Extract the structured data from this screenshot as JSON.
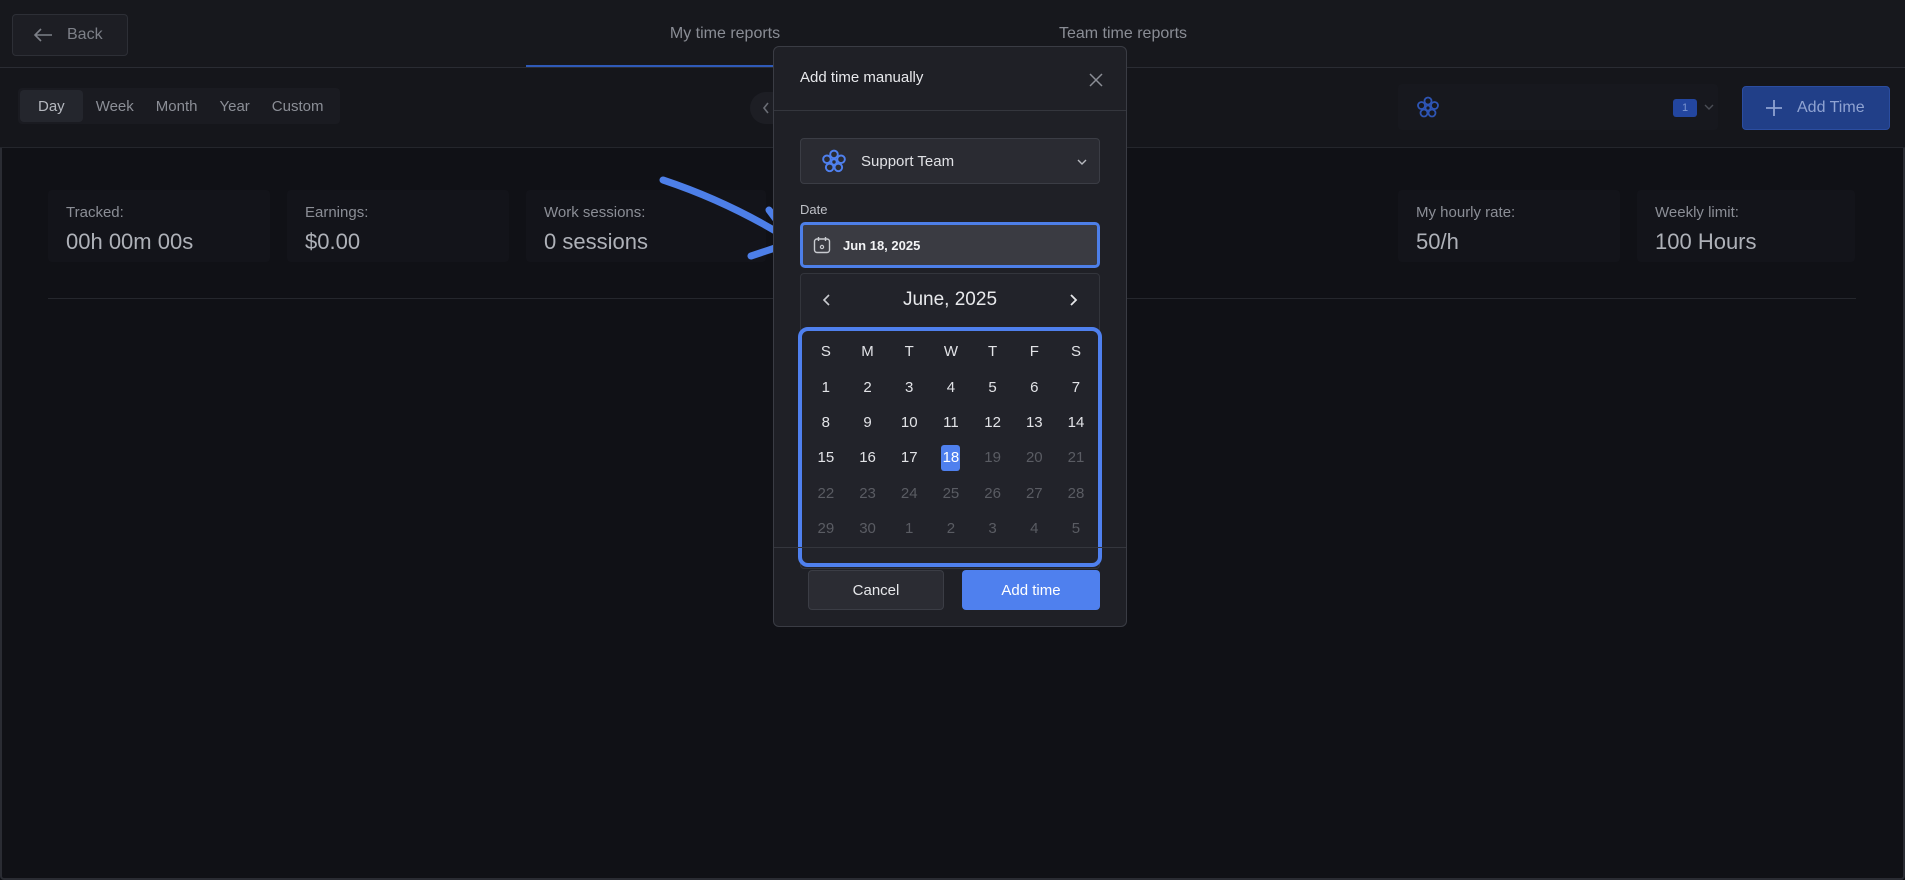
{
  "header": {
    "back_label": "Back",
    "tabs": [
      {
        "label": "My time reports",
        "active": true
      },
      {
        "label": "Team time reports",
        "active": false
      }
    ]
  },
  "toolbar": {
    "ranges": [
      {
        "label": "Day",
        "active": true
      },
      {
        "label": "Week",
        "active": false
      },
      {
        "label": "Month",
        "active": false
      },
      {
        "label": "Year",
        "active": false
      },
      {
        "label": "Custom",
        "active": false
      }
    ],
    "team_count": "1",
    "add_time_label": "Add Time"
  },
  "stats": [
    {
      "label": "Tracked:",
      "value": "00h 00m 00s"
    },
    {
      "label": "Earnings:",
      "value": "$0.00"
    },
    {
      "label": "Work sessions:",
      "value": "0 sessions"
    },
    {
      "label": "My hourly rate:",
      "value": "50/h"
    },
    {
      "label": "Weekly limit:",
      "value": "100 Hours"
    }
  ],
  "modal": {
    "title": "Add time manually",
    "team_name": "Support Team",
    "date_label": "Date",
    "date_value": "Jun 18, 2025",
    "calendar": {
      "month_label": "June, 2025",
      "weekdays": [
        "S",
        "M",
        "T",
        "W",
        "T",
        "F",
        "S"
      ],
      "days": [
        {
          "d": "1"
        },
        {
          "d": "2"
        },
        {
          "d": "3"
        },
        {
          "d": "4"
        },
        {
          "d": "5"
        },
        {
          "d": "6"
        },
        {
          "d": "7"
        },
        {
          "d": "8"
        },
        {
          "d": "9"
        },
        {
          "d": "10"
        },
        {
          "d": "11"
        },
        {
          "d": "12"
        },
        {
          "d": "13"
        },
        {
          "d": "14"
        },
        {
          "d": "15"
        },
        {
          "d": "16"
        },
        {
          "d": "17"
        },
        {
          "d": "18",
          "selected": true
        },
        {
          "d": "19",
          "muted": true
        },
        {
          "d": "20",
          "muted": true
        },
        {
          "d": "21",
          "muted": true
        },
        {
          "d": "22",
          "muted": true
        },
        {
          "d": "23",
          "muted": true
        },
        {
          "d": "24",
          "muted": true
        },
        {
          "d": "25",
          "muted": true
        },
        {
          "d": "26",
          "muted": true
        },
        {
          "d": "27",
          "muted": true
        },
        {
          "d": "28",
          "muted": true
        },
        {
          "d": "29",
          "muted": true
        },
        {
          "d": "30",
          "muted": true
        },
        {
          "d": "1",
          "muted": true
        },
        {
          "d": "2",
          "muted": true
        },
        {
          "d": "3",
          "muted": true
        },
        {
          "d": "4",
          "muted": true
        },
        {
          "d": "5",
          "muted": true
        }
      ]
    },
    "cancel_label": "Cancel",
    "add_label": "Add time"
  },
  "colors": {
    "accent": "#4f80ee",
    "background": "#101116",
    "modal_bg": "#1f2026"
  },
  "icons": [
    "arrow-left-icon",
    "close-icon",
    "team-flower-icon",
    "chevron-down-icon",
    "calendar-icon",
    "chevron-left-icon",
    "chevron-right-icon",
    "plus-icon"
  ]
}
